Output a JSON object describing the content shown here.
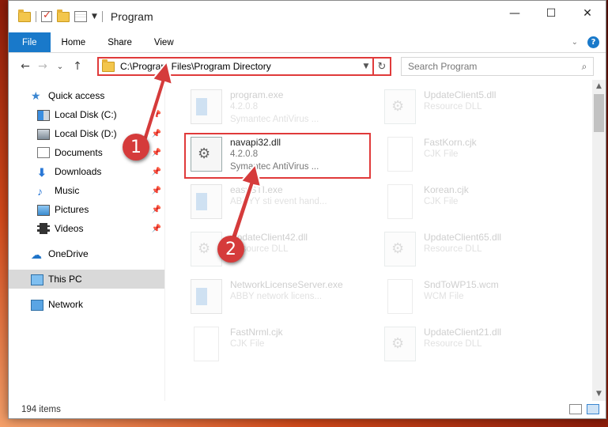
{
  "window": {
    "title": "Program",
    "controls": {
      "minimize": "—",
      "maximize": "☐",
      "close": "✕"
    }
  },
  "ribbon": {
    "tabs": [
      "File",
      "Home",
      "Share",
      "View"
    ]
  },
  "navbar": {
    "back": "←",
    "forward": "→",
    "recent": "⌄",
    "up": "↑",
    "address": "C:\\Program Files\\Program Directory",
    "search_placeholder": "Search Program"
  },
  "sidebar": {
    "items": [
      {
        "label": "Quick access",
        "icon": "star-icon"
      },
      {
        "label": "Local Disk (C:)",
        "icon": "disk-icon",
        "pinned": true
      },
      {
        "label": "Local Disk (D:)",
        "icon": "disk-icon",
        "pinned": true
      },
      {
        "label": "Documents",
        "icon": "documents-icon",
        "pinned": true
      },
      {
        "label": "Downloads",
        "icon": "download-icon",
        "pinned": true
      },
      {
        "label": "Music",
        "icon": "music-icon",
        "pinned": true
      },
      {
        "label": "Pictures",
        "icon": "pictures-icon",
        "pinned": true
      },
      {
        "label": "Videos",
        "icon": "videos-icon",
        "pinned": true
      },
      {
        "label": "OneDrive",
        "icon": "onedrive-icon"
      },
      {
        "label": "This PC",
        "icon": "pc-icon",
        "selected": true
      },
      {
        "label": "Network",
        "icon": "network-icon"
      }
    ]
  },
  "files": [
    {
      "name": "program.exe",
      "line2": "4.2.0.8",
      "line3": "Symantec AntiVirus ...",
      "icon": "exe-icon",
      "faded": true
    },
    {
      "name": "UpdateClient5.dll",
      "line2": "Resource DLL",
      "line3": "",
      "icon": "dll-icon",
      "faded": true
    },
    {
      "name": "navapi32.dll",
      "line2": "4.2.0.8",
      "line3": "Symantec AntiVirus ...",
      "icon": "dll-icon",
      "faded": false
    },
    {
      "name": "FastKorn.cjk",
      "line2": "CJK File",
      "line3": "",
      "icon": "file-icon",
      "faded": true
    },
    {
      "name": "easySTI.exe",
      "line2": "ABBYY sti event hand...",
      "line3": "",
      "icon": "exe-icon",
      "faded": true
    },
    {
      "name": "Korean.cjk",
      "line2": "CJK File",
      "line3": "",
      "icon": "file-icon",
      "faded": true
    },
    {
      "name": "UpdateClient42.dll",
      "line2": "Resource DLL",
      "line3": "",
      "icon": "dll-icon",
      "faded": true
    },
    {
      "name": "UpdateClient65.dll",
      "line2": "Resource DLL",
      "line3": "",
      "icon": "dll-icon",
      "faded": true
    },
    {
      "name": "NetworkLicenseServer.exe",
      "line2": "ABBY network licens...",
      "line3": "",
      "icon": "exe-icon",
      "faded": true
    },
    {
      "name": "SndToWP15.wcm",
      "line2": "WCM File",
      "line3": "",
      "icon": "file-icon",
      "faded": true
    },
    {
      "name": "FastNrml.cjk",
      "line2": "CJK File",
      "line3": "",
      "icon": "file-icon",
      "faded": true
    },
    {
      "name": "UpdateClient21.dll",
      "line2": "Resource DLL",
      "line3": "",
      "icon": "dll-icon",
      "faded": true
    }
  ],
  "status": {
    "item_count": "194 items"
  },
  "annotations": {
    "step1": "1",
    "step2": "2",
    "color": "#d53b3b"
  }
}
